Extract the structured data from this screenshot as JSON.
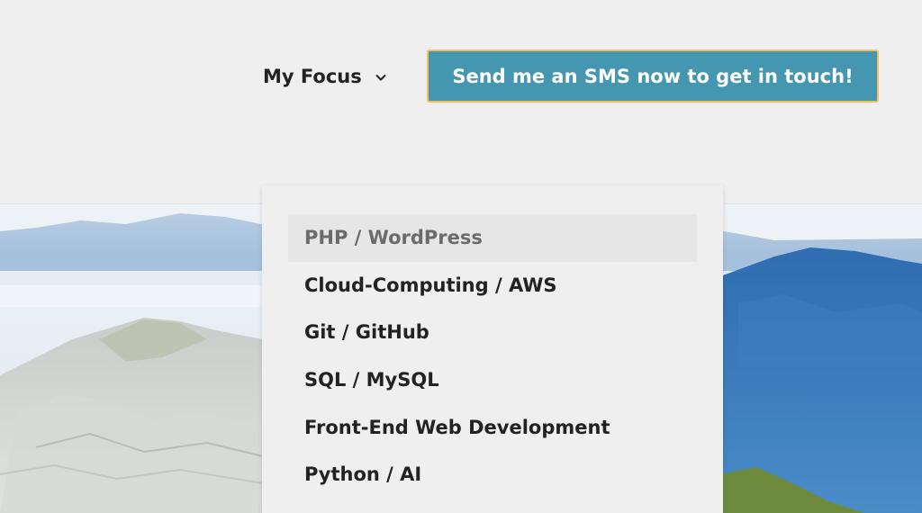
{
  "nav": {
    "my_focus_label": "My Focus",
    "cta_label": "Send me an SMS now to get in touch!"
  },
  "dropdown": {
    "items": [
      {
        "label": "PHP / WordPress",
        "active": true
      },
      {
        "label": "Cloud-Computing / AWS"
      },
      {
        "label": "Git / GitHub"
      },
      {
        "label": "SQL / MySQL"
      },
      {
        "label": "Front-End Web Development"
      },
      {
        "label": "Python / AI"
      }
    ]
  },
  "icons": {
    "chevron": "chevron-down-icon"
  },
  "colors": {
    "background": "#efefef",
    "cta_background": "#4496b1",
    "cta_border": "#f1c060",
    "text": "#222222",
    "active_item_text": "#6b6b6b"
  }
}
